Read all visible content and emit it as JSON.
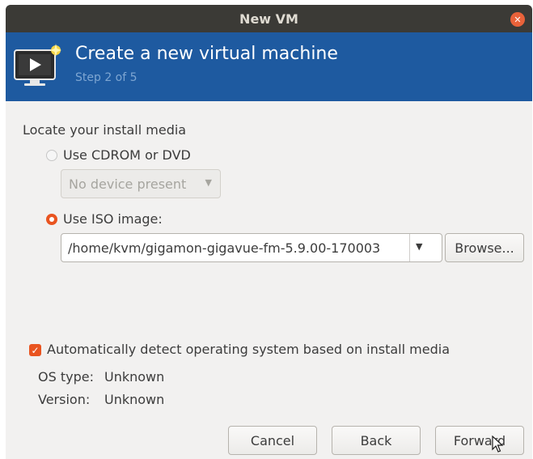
{
  "window": {
    "title": "New VM",
    "close_icon": "close-icon"
  },
  "banner": {
    "title": "Create a new virtual machine",
    "step": "Step 2 of 5",
    "icon": "monitor-new-icon"
  },
  "install_media": {
    "heading": "Locate your install media",
    "cdrom_option": {
      "label": "Use CDROM or DVD",
      "selected": false
    },
    "device_select": {
      "value": "No device present",
      "enabled": false
    },
    "iso_option": {
      "label": "Use ISO image:",
      "selected": true
    },
    "iso_path": "/home/kvm/gigamon-gigavue-fm-5.9.00-170003",
    "browse_label": "Browse..."
  },
  "os_detection": {
    "auto_detect_label": "Automatically detect operating system based on install media",
    "auto_detect_checked": true,
    "os_type_label": "OS type:",
    "os_type_value": "Unknown",
    "version_label": "Version:",
    "version_value": "Unknown"
  },
  "buttons": {
    "cancel": "Cancel",
    "back": "Back",
    "forward": "Forward"
  },
  "colors": {
    "titlebar": "#3b3a36",
    "banner": "#1e5aa0",
    "accent": "#e95420"
  }
}
